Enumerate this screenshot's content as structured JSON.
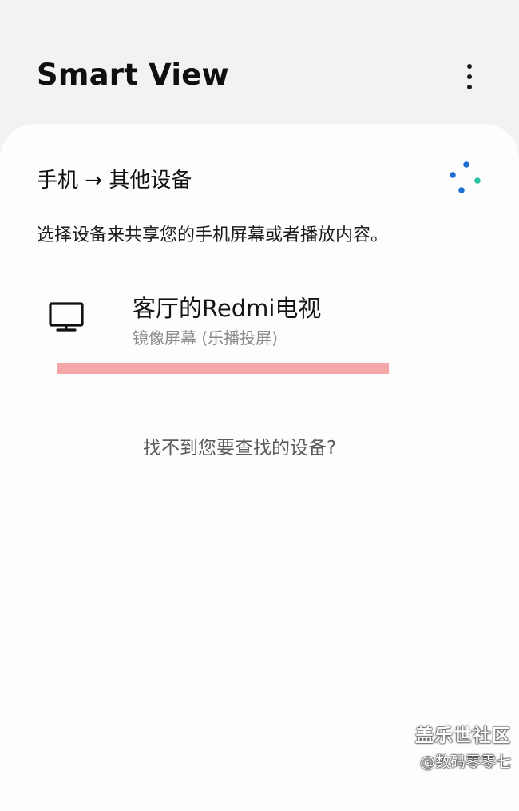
{
  "app_bar": {
    "title": "Smart View",
    "more_icon": "more-vertical-icon"
  },
  "card": {
    "section_title": "手机 → 其他设备",
    "scan_icon": "scanning-dots-icon",
    "description": "选择设备来共享您的手机屏幕或者播放内容。",
    "devices": [
      {
        "icon": "tv-icon",
        "name": "客厅的Redmi电视",
        "status": "镜像屏幕 (乐播投屏)"
      }
    ],
    "help_link": "找不到您要查找的设备?"
  },
  "watermark": {
    "line1": "盖乐世社区",
    "line2": "@数码零零七"
  },
  "colors": {
    "background": "#f2f2f2",
    "card": "#fdfdfd",
    "scan_blue": "#1f6fd1",
    "scan_teal": "#2bc3a5",
    "redaction": "#f4a6a8"
  }
}
